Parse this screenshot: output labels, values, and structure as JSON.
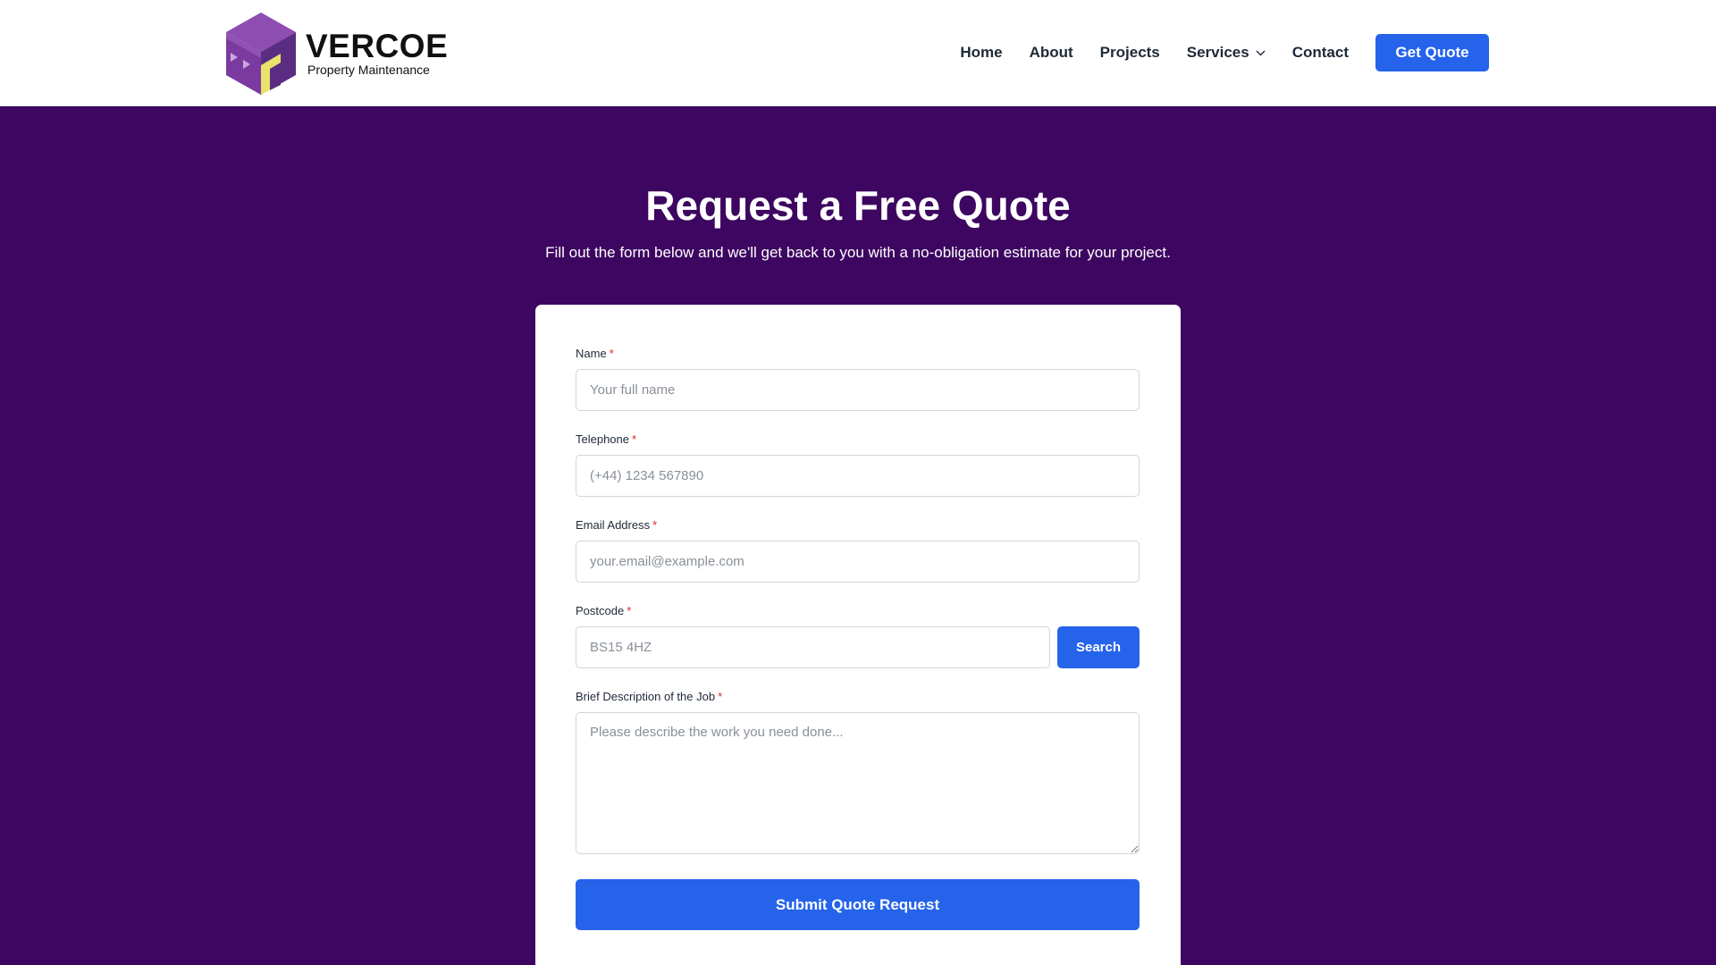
{
  "brand": {
    "name": "VERCOE",
    "tagline": "Property Maintenance",
    "colors": {
      "purple_dark": "#5b2d82",
      "purple_light": "#8e4db3",
      "yellow": "#e9e36b"
    }
  },
  "nav": {
    "items": [
      {
        "label": "Home"
      },
      {
        "label": "About"
      },
      {
        "label": "Projects"
      },
      {
        "label": "Services",
        "has_dropdown": true
      },
      {
        "label": "Contact"
      }
    ],
    "cta_label": "Get Quote"
  },
  "hero": {
    "title": "Request a Free Quote",
    "subtitle": "Fill out the form below and we'll get back to you with a no-obligation estimate for your project."
  },
  "form": {
    "required_marker": "*",
    "name": {
      "label": "Name",
      "placeholder": "Your full name",
      "value": ""
    },
    "telephone": {
      "label": "Telephone",
      "placeholder": "(+44) 1234 567890",
      "value": ""
    },
    "email": {
      "label": "Email Address",
      "placeholder": "your.email@example.com",
      "value": ""
    },
    "postcode": {
      "label": "Postcode",
      "placeholder": "BS15 4HZ",
      "value": "",
      "search_label": "Search"
    },
    "description": {
      "label": "Brief Description of the Job",
      "placeholder": "Please describe the work you need done...",
      "value": ""
    },
    "submit_label": "Submit Quote Request"
  },
  "colors": {
    "page_background": "#3d0660",
    "accent": "#2563eb",
    "required": "#dc2626"
  }
}
